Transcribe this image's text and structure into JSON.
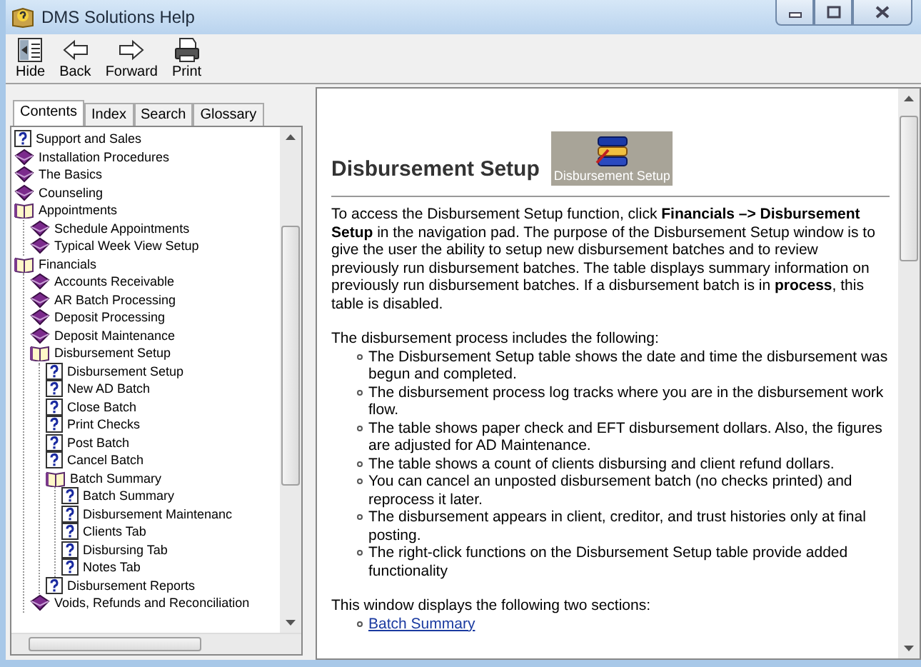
{
  "window": {
    "title": "DMS Solutions Help"
  },
  "toolbar": [
    {
      "kind": "hide",
      "label": "Hide"
    },
    {
      "kind": "back",
      "label": "Back"
    },
    {
      "kind": "forward",
      "label": "Forward"
    },
    {
      "kind": "print",
      "label": "Print"
    }
  ],
  "tabs": [
    {
      "label": "Contents",
      "selected": true
    },
    {
      "label": "Index",
      "selected": false
    },
    {
      "label": "Search",
      "selected": false
    },
    {
      "label": "Glossary",
      "selected": false
    }
  ],
  "tree": [
    {
      "kind": "page",
      "label": "Support and Sales"
    },
    {
      "kind": "book",
      "label": "Installation Procedures",
      "expanded": false
    },
    {
      "kind": "book",
      "label": "The Basics",
      "expanded": false
    },
    {
      "kind": "book",
      "label": "Counseling",
      "expanded": false
    },
    {
      "kind": "book",
      "label": "Appointments",
      "expanded": true,
      "children": [
        {
          "kind": "book",
          "label": "Schedule Appointments",
          "expanded": false
        },
        {
          "kind": "book",
          "label": "Typical Week View Setup",
          "expanded": false
        }
      ]
    },
    {
      "kind": "book",
      "label": "Financials",
      "expanded": true,
      "children": [
        {
          "kind": "book",
          "label": "Accounts Receivable",
          "expanded": false
        },
        {
          "kind": "book",
          "label": "AR Batch Processing",
          "expanded": false
        },
        {
          "kind": "book",
          "label": "Deposit Processing",
          "expanded": false
        },
        {
          "kind": "book",
          "label": "Deposit Maintenance",
          "expanded": false
        },
        {
          "kind": "book",
          "label": "Disbursement Setup",
          "expanded": true,
          "children": [
            {
              "kind": "page",
              "label": "Disbursement Setup"
            },
            {
              "kind": "page",
              "label": "New AD Batch"
            },
            {
              "kind": "page",
              "label": "Close Batch"
            },
            {
              "kind": "page",
              "label": "Print Checks"
            },
            {
              "kind": "page",
              "label": "Post Batch"
            },
            {
              "kind": "page",
              "label": "Cancel Batch"
            },
            {
              "kind": "book",
              "label": "Batch Summary",
              "expanded": true,
              "children": [
                {
                  "kind": "page",
                  "label": "Batch Summary"
                },
                {
                  "kind": "page",
                  "label": "Disbursement Maintenanc"
                },
                {
                  "kind": "page",
                  "label": "Clients Tab"
                },
                {
                  "kind": "page",
                  "label": "Disbursing Tab"
                },
                {
                  "kind": "page",
                  "label": "Notes Tab"
                }
              ]
            },
            {
              "kind": "page",
              "label": "Disbursement Reports"
            }
          ]
        },
        {
          "kind": "book",
          "label": "Voids, Refunds and Reconciliation",
          "expanded": false
        }
      ]
    }
  ],
  "topic": {
    "title": "Disbursement Setup",
    "image_caption": "Disbursement Setup",
    "intro": "To access the Disbursement Setup function, click **Financials –> Disbursement Setup** in the navigation pad. The purpose of the Disbursement Setup window is to give the user the ability to setup new disbursement batches and to review previously run disbursement batches.  The table displays summary information on previously run disbursement batches.  If a disbursement batch is in **process**, this table is disabled.",
    "list_intro": "The disbursement process includes the following:",
    "bullets": [
      "The Disbursement Setup table shows the date and time the disbursement was begun and completed.",
      "The disbursement process log tracks where you are in the disbursement work flow.",
      "The table shows paper check and EFT disbursement dollars. Also, the figures are adjusted for AD Maintenance.",
      "The table shows a count of clients disbursing and client refund dollars.",
      "You can cancel an unposted disbursement batch (no checks printed) and reprocess it later.",
      "The disbursement appears in client, creditor, and trust histories only at final posting.",
      "The right-click functions on the Disbursement Setup table provide added functionality"
    ],
    "sections_intro": "This window displays the following two sections:",
    "links": [
      "Batch Summary"
    ]
  }
}
